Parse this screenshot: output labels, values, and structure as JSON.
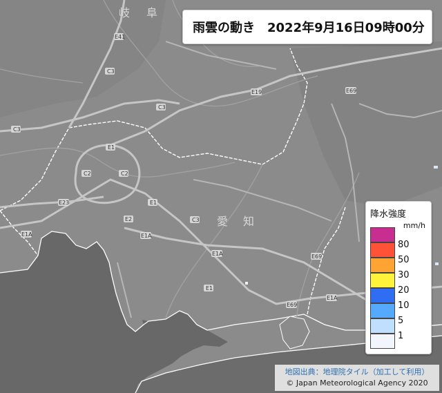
{
  "title": {
    "label": "雨雲の動き",
    "datetime": "2022年9月16日09時00分"
  },
  "map": {
    "prefecture_labels": {
      "gifu": [
        "岐",
        "阜"
      ],
      "aichi": [
        "愛",
        "知"
      ]
    }
  },
  "legend": {
    "title": "降水強度",
    "unit": "mm/h",
    "levels": [
      {
        "label": "80",
        "color": "#c72e8f"
      },
      {
        "label": "50",
        "color": "#ff5236"
      },
      {
        "label": "30",
        "color": "#ffa433"
      },
      {
        "label": "20",
        "color": "#fff23a"
      },
      {
        "label": "10",
        "color": "#2f6df2"
      },
      {
        "label": "5",
        "color": "#55a9ff"
      },
      {
        "label": "1",
        "color": "#c0dfff"
      },
      {
        "label": "",
        "color": "#f2f5fb"
      }
    ]
  },
  "credits": {
    "map_source": "地図出典：地理院タイル（加工して利用）",
    "copyright": "© Japan Meteorological Agency 2020"
  }
}
